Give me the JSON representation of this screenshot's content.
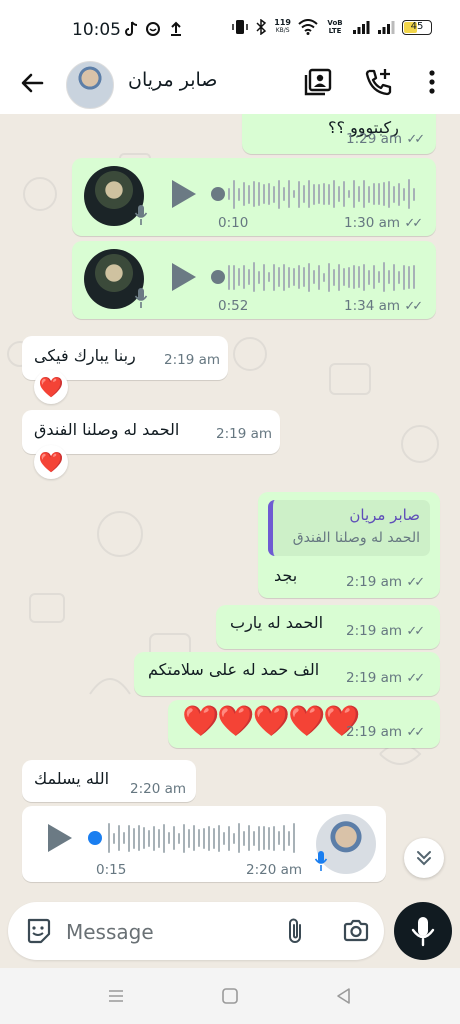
{
  "status_bar": {
    "time": "10:05",
    "speed_value": "119",
    "speed_unit": "KB/S",
    "network_label": "VoB LTE",
    "battery": "45"
  },
  "header": {
    "contact_name": "صابر مريان"
  },
  "messages": [
    {
      "dir": "out",
      "type": "text",
      "text": "ركبتووو ؟؟",
      "time": "1:29 am",
      "status": "read"
    },
    {
      "dir": "out",
      "type": "voice",
      "duration": "0:10",
      "time": "1:30 am",
      "status": "read"
    },
    {
      "dir": "out",
      "type": "voice",
      "duration": "0:52",
      "time": "1:34 am",
      "status": "read"
    },
    {
      "dir": "in",
      "type": "text",
      "text": "ربنا يبارك فيكى",
      "time": "2:19 am",
      "reaction": "❤️"
    },
    {
      "dir": "in",
      "type": "text",
      "text": "الحمد له وصلنا الفندق",
      "time": "2:19 am",
      "reaction": "❤️"
    },
    {
      "dir": "out",
      "type": "reply",
      "quoted_author": "صابر مريان",
      "quoted_text": "الحمد له وصلنا الفندق",
      "text": "بجد",
      "time": "2:19 am",
      "status": "read"
    },
    {
      "dir": "out",
      "type": "text",
      "text": "الحمد له يارب",
      "time": "2:19 am",
      "status": "read"
    },
    {
      "dir": "out",
      "type": "text",
      "text": "الف حمد له على سلامتكم",
      "time": "2:19 am",
      "status": "read"
    },
    {
      "dir": "out",
      "type": "emoji",
      "text": "❤️❤️❤️❤️❤️",
      "time": "2:19 am",
      "status": "read"
    },
    {
      "dir": "in",
      "type": "text",
      "text": "الله يسلمك",
      "time": "2:20 am"
    },
    {
      "dir": "in",
      "type": "voice",
      "duration": "0:15",
      "time": "2:20 am"
    }
  ],
  "input": {
    "placeholder": "Message"
  },
  "colors": {
    "outgoing_bubble": "#d9fdd3",
    "incoming_bubble": "#ffffff",
    "chat_background": "#efeae2",
    "voice_dot_outgoing": "#6b7a84",
    "voice_dot_incoming": "#1a7ef0",
    "mic_button": "#111b21"
  },
  "icons": [
    "back-arrow-icon",
    "contact-card-icon",
    "add-call-icon",
    "more-vert-icon",
    "play-icon",
    "mic-icon",
    "sticker-icon",
    "attach-icon",
    "camera-icon",
    "chevron-double-down-icon",
    "nav-menu-icon",
    "nav-home-icon",
    "nav-back-icon"
  ]
}
